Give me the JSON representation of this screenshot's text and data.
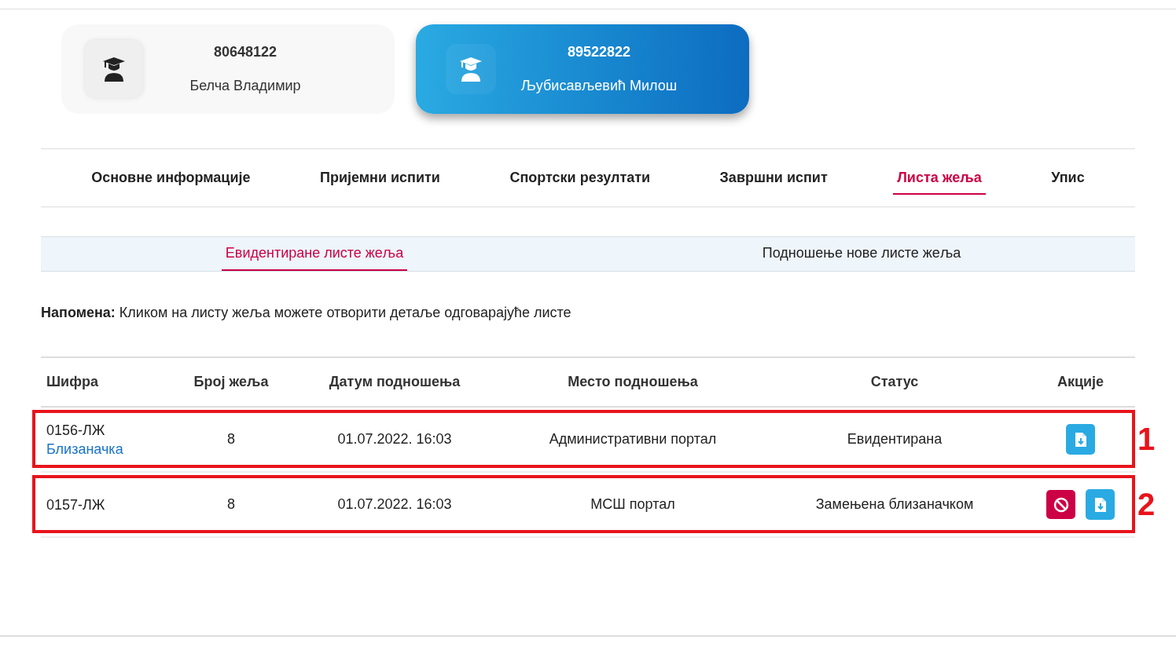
{
  "students": [
    {
      "id": "80648122",
      "name": "Белча Владимир",
      "selected": false
    },
    {
      "id": "89522822",
      "name": "Љубисављевић Милош",
      "selected": true
    }
  ],
  "tabs": [
    {
      "label": "Основне информације",
      "selected": false
    },
    {
      "label": "Пријемни испити",
      "selected": false
    },
    {
      "label": "Спортски резултати",
      "selected": false
    },
    {
      "label": "Завршни испит",
      "selected": false
    },
    {
      "label": "Листа жеља",
      "selected": true
    },
    {
      "label": "Упис",
      "selected": false
    }
  ],
  "subtabs": [
    {
      "label": "Евидентиране листе жеља",
      "selected": true
    },
    {
      "label": "Подношење нове листе жеља",
      "selected": false
    }
  ],
  "note": "**Напомена:** Кликом на листу жеља можете отворити детаље одговарајуће листе",
  "table": {
    "columns": [
      "Шифра",
      "Број жеља",
      "Датум подношења",
      "Место подношења",
      "Статус",
      "Акције"
    ],
    "rows": [
      {
        "code": "0156-ЛЖ",
        "link": "Близаначка",
        "count": "8",
        "date": "01.07.2022. 16:03",
        "place": "Административни портал",
        "status": "Евидентирана",
        "actions": [
          {
            "kind": "download"
          }
        ],
        "annotation": "1"
      },
      {
        "code": "0157-ЛЖ",
        "count": "8",
        "date": "01.07.2022. 16:03",
        "place": "МСШ портал",
        "status": "Замењена близаначком",
        "actions": [
          {
            "kind": "cancel"
          },
          {
            "kind": "download"
          }
        ],
        "annotation": "2"
      }
    ]
  }
}
